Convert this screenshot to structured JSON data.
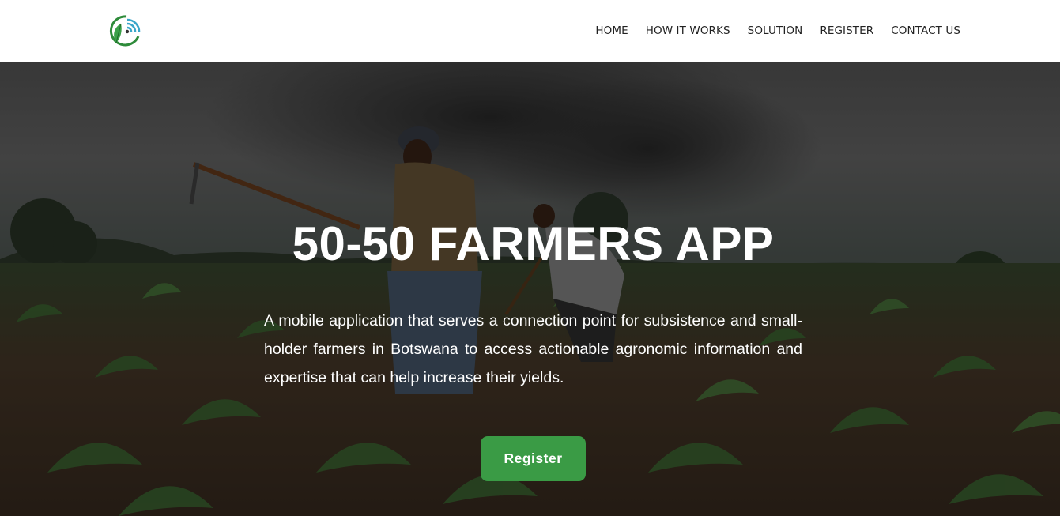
{
  "brand": {
    "logo_icon": "leaf-wifi-logo-icon",
    "accent": "#3a9b45",
    "logo_signal": "#3aa6c9"
  },
  "nav": {
    "items": [
      {
        "label": "HOME"
      },
      {
        "label": "HOW IT WORKS"
      },
      {
        "label": "SOLUTION"
      },
      {
        "label": "REGISTER"
      },
      {
        "label": "CONTACT US"
      }
    ]
  },
  "hero": {
    "title": "50-50 FARMERS APP",
    "description": "A mobile application that serves a connection point for subsistence and small-holder farmers in Botswana to access actionable agronomic information and expertise that can help increase their yields.",
    "cta_label": "Register",
    "background_image": "farmers-field-photo"
  }
}
